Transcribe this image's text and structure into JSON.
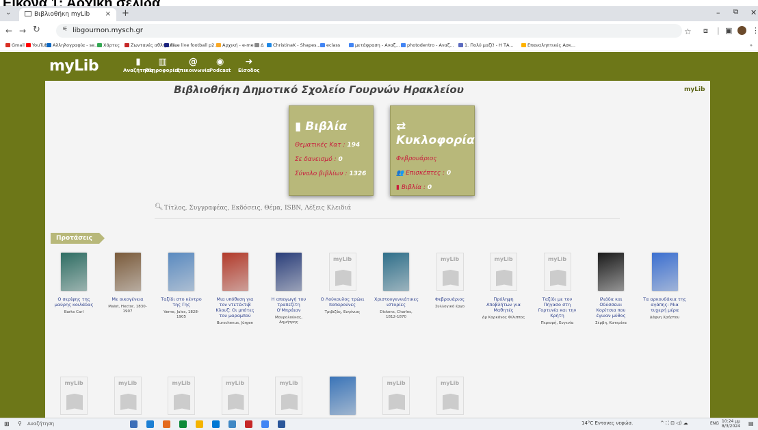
{
  "caption": "Εικόνα 1: Αρχική σελίδα",
  "browser": {
    "tab_title": "Βιβλιοθήκη myLib",
    "tab_close": "×",
    "new_tab": "+",
    "tab_menu": "⌄",
    "url": "libgournon.mysch.gr",
    "bookmarks": [
      {
        "label": "Gmail",
        "color": "#d93025"
      },
      {
        "label": "YouTube",
        "color": "#ff0000"
      },
      {
        "label": "Αλληλογραφία - se...",
        "color": "#0a66c2"
      },
      {
        "label": "Χάρτες",
        "color": "#34a853"
      },
      {
        "label": "Ζωντανές αθλητικέ...",
        "color": "#c62828"
      },
      {
        "label": "Free live football p2...",
        "color": "#1a237e"
      },
      {
        "label": "Αρχική - e-me",
        "color": "#f9a825"
      },
      {
        "label": "Δ",
        "color": "#888888"
      },
      {
        "label": "ChristinaK - Shapes...",
        "color": "#1e88e5"
      },
      {
        "label": "eclass",
        "color": "#4285f4"
      },
      {
        "label": "μετάφραση - Αναζ...",
        "color": "#4285f4"
      },
      {
        "label": "photodentro - Αναζ...",
        "color": "#4285f4"
      },
      {
        "label": "1. Πολύ μαζί! - Η ΤΑ...",
        "color": "#5c6bc0"
      },
      {
        "label": "Επαναληπτικές Ασκ...",
        "color": "#ffb300"
      }
    ],
    "more_bookmarks": "»"
  },
  "site": {
    "logo": "myLib",
    "logo_small": "myLib",
    "nav": [
      {
        "icon": "▮",
        "label": "Αναζήτηση"
      },
      {
        "icon": "▥",
        "label": "Πληροφορίες"
      },
      {
        "icon": "@",
        "label": "Επικοινωνία"
      },
      {
        "icon": "◉",
        "label": "Podcast"
      },
      {
        "icon": "➜",
        "label": "Είσοδος"
      }
    ],
    "title": "Βιβλιοθήκη Δημοτικό Σχολείο Γουρνών Ηρακλείου",
    "books_box": {
      "heading": "Βιβλία",
      "heading_icon": "▮",
      "rows": [
        {
          "label": "Θεματικές Κατ :",
          "value": "194"
        },
        {
          "label": "Σε δανεισμό :",
          "value": "0"
        },
        {
          "label": "Σύνολο βιβλίων :",
          "value": "1326"
        }
      ]
    },
    "circ_box": {
      "heading": "Κυκλοφορία",
      "heading_icon": "⇄",
      "month": "Φεβρουάριος",
      "visitors_label": "Επισκέπτες :",
      "visitors_value": "0",
      "visitors_icon": "👥",
      "books_label": "Βιβλία :",
      "books_value": "0",
      "books_icon": "▮"
    },
    "search_placeholder": "Τίτλος, Συγγραφέας, Εκδόσεις, Θέμα, ISBN, Λέξεις Κλειδιά",
    "proposals_label": "Προτάσεις",
    "placeholder_text": "myLib",
    "books_row1": [
      {
        "title": "Ο σερίφης της μαύρης κοιλάδας",
        "author": "Barks Carl",
        "cover": "#2e6d63",
        "placeholder": false
      },
      {
        "title": "Με οικογένεια",
        "author": "Malot, Hector, 1830-1907",
        "cover": "#7a5a3a",
        "placeholder": false
      },
      {
        "title": "Ταξίδι στο κέντρο της Γης",
        "author": "Verne, Jules, 1828-1905",
        "cover": "#5a8ac0",
        "placeholder": false
      },
      {
        "title": "Μια υπόθεση για τον ντετέκτιβ Κλουζ: Οι μπότες του μαραμπού",
        "author": "Burschenus, Jürgen",
        "cover": "#b23a2a",
        "placeholder": false
      },
      {
        "title": "Η απαγωγή του τραπεζίτη Ο'Μπράιαν",
        "author": "Μαυρολούκας, Δημήτρης",
        "cover": "#2a3e7a",
        "placeholder": false
      },
      {
        "title": "Ο Λούκουλος τρώει ποπαρούνες",
        "author": "Τριβιζάς, Ευγένιος",
        "cover": "",
        "placeholder": true
      },
      {
        "title": "Χριστουγεννιάτικες ιστορίες",
        "author": "Dickens, Charles, 1812-1870",
        "cover": "#2f6f8a",
        "placeholder": false
      },
      {
        "title": "Φεβρουάριος",
        "author": "Συλλογικό έργο",
        "cover": "",
        "placeholder": true
      },
      {
        "title": "Πρόληψη Αποβλήτων για Μαθητές",
        "author": "Δρ Καρκάνος Φίλιππος",
        "cover": "",
        "placeholder": true
      },
      {
        "title": "Ταξίδι με τον Πήγασο στη Γορτυνία και την Κρήτη",
        "author": "Περισρή, Ευγενία",
        "cover": "",
        "placeholder": true
      },
      {
        "title": "Ιλιάδα και Οδύσσεια: Κορίτσια που έγιναν μύθος",
        "author": "Σέρβη, Κατερίνα",
        "cover": "#1a1a1a",
        "placeholder": false
      },
      {
        "title": "Τα αρκουδάκια της αγάπης: Μια τυχερή μέρα",
        "author": "Δάφνη Χρήστου",
        "cover": "#3b6fd0",
        "placeholder": false
      }
    ],
    "books_row2": [
      {
        "cover": "",
        "placeholder": true
      },
      {
        "cover": "",
        "placeholder": true
      },
      {
        "cover": "",
        "placeholder": true
      },
      {
        "cover": "",
        "placeholder": true
      },
      {
        "cover": "",
        "placeholder": true
      },
      {
        "cover": "#3a74b8",
        "placeholder": false
      },
      {
        "cover": "",
        "placeholder": true
      },
      {
        "cover": "",
        "placeholder": true
      }
    ]
  },
  "taskbar": {
    "search": "Αναζήτηση",
    "weather": "14°C Εντονες νεφώσ.",
    "tray": "^ ⛶ ⊡ ◁) ☁",
    "lang": "ENG",
    "time": "10:24 μμ",
    "date": "8/3/2024",
    "apps": [
      "#3d6fb8",
      "#1b7fd4",
      "#e46b1e",
      "#0e8a3a",
      "#f4b400",
      "#0078d4",
      "#3f88c5",
      "#c62828",
      "#4285f4",
      "#2b579a"
    ]
  }
}
